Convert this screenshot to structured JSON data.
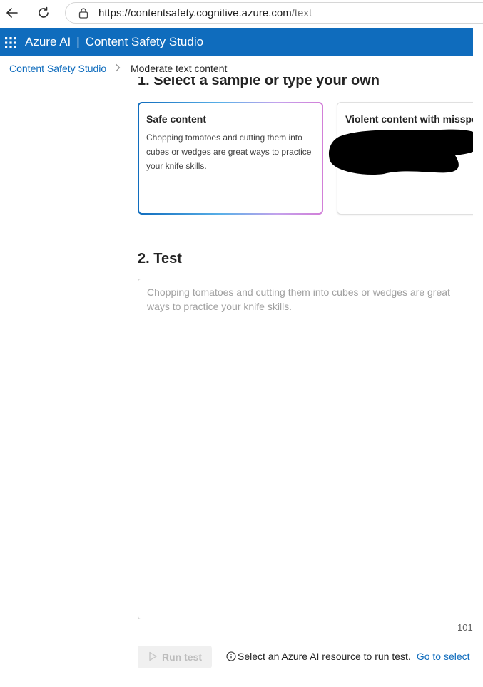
{
  "browser": {
    "url_host": "https://contentsafety.cognitive.azure.com",
    "url_path": "/text"
  },
  "header": {
    "brand": "Azure AI",
    "separator": "|",
    "product": "Content Safety Studio",
    "color": "#0f6cbd"
  },
  "breadcrumb": {
    "root": "Content Safety Studio",
    "current": "Moderate text content"
  },
  "section1": {
    "title": "1. Select a sample or type your own",
    "cards": [
      {
        "title": "Safe content",
        "body": "Chopping tomatoes and cutting them into cubes or wedges are great ways to practice your knife skills.",
        "selected": true
      },
      {
        "title": "Violent content with misspel",
        "body": "",
        "selected": false
      }
    ]
  },
  "section2": {
    "title": "2. Test",
    "placeholder": "Chopping tomatoes and cutting them into cubes or wedges are great ways to practice your knife skills.",
    "char_count": "101"
  },
  "actions": {
    "run_label": "Run test",
    "info_text": "Select an Azure AI resource to run test.",
    "go_link": "Go to select"
  },
  "icons": {
    "back": "back-arrow-icon",
    "refresh": "refresh-icon",
    "lock": "lock-icon",
    "waffle": "app-launcher-icon",
    "chevron": "chevron-right-icon",
    "play": "play-icon",
    "info": "info-icon"
  }
}
